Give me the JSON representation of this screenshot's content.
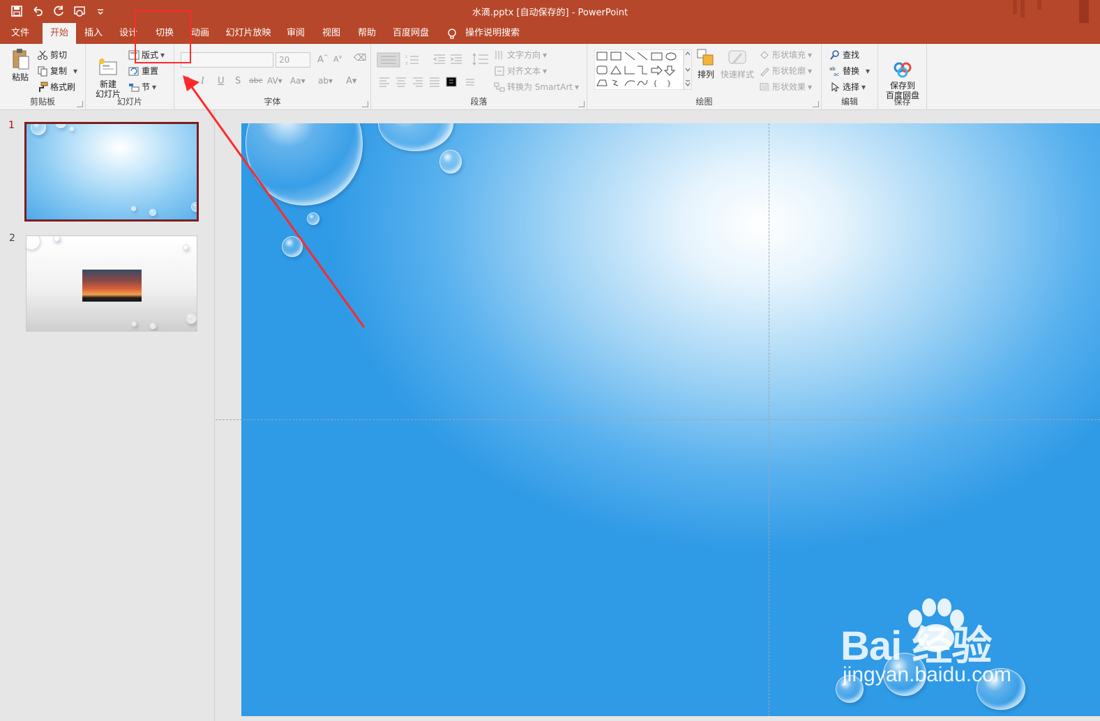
{
  "title_bar": {
    "title": "水滴.pptx [自动保存的]  -  PowerPoint"
  },
  "tabs": [
    "文件",
    "开始",
    "插入",
    "设计",
    "切换",
    "动画",
    "幻灯片放映",
    "审阅",
    "视图",
    "帮助",
    "百度网盘"
  ],
  "tell_me": "操作说明搜索",
  "ribbon": {
    "clipboard": {
      "label": "剪贴板",
      "paste": "粘贴",
      "cut": "剪切",
      "copy": "复制",
      "format_painter": "格式刷"
    },
    "slides": {
      "label": "幻灯片",
      "new_slide": "新建\n幻灯片",
      "layout": "版式",
      "reset": "重置",
      "section": "节"
    },
    "font": {
      "label": "字体",
      "font_name": "",
      "font_size": "20"
    },
    "paragraph": {
      "label": "段落",
      "text_direction": "文字方向",
      "align_text": "对齐文本",
      "convert_smartart": "转换为 SmartArt"
    },
    "drawing": {
      "label": "绘图",
      "arrange": "排列",
      "quick_styles": "快速样式",
      "shape_fill": "形状填充",
      "shape_outline": "形状轮廓",
      "shape_effects": "形状效果"
    },
    "editing": {
      "label": "编辑",
      "find": "查找",
      "replace": "替换",
      "select": "选择"
    },
    "save": {
      "label": "保存",
      "save_to_baidu": "保存到\n百度网盘"
    }
  },
  "slides_panel": {
    "slide_numbers": [
      "1",
      "2"
    ]
  },
  "watermark": {
    "brand": "Bai 经验",
    "url": "jingyan.baidu.com"
  },
  "colors": {
    "accent": "#b7472a",
    "highlight_box": "#ff2a2a",
    "selected_thumb_border": "#7b1f1f"
  }
}
